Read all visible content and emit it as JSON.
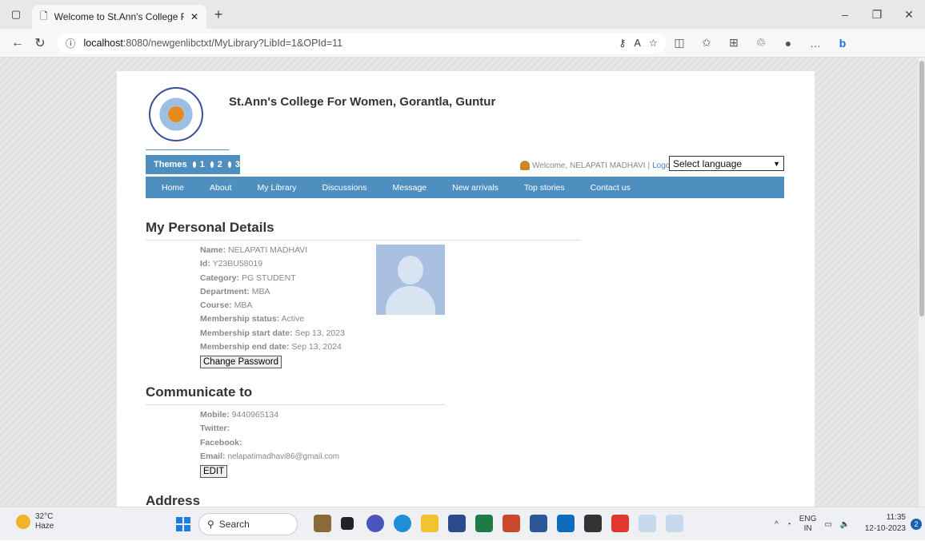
{
  "browser": {
    "tab_title": "Welcome to St.Ann's College For",
    "url_host": "localhost",
    "url_path": ":8080/newgenlibctxt/MyLibrary?LibId=1&OPId=11"
  },
  "site": {
    "college_name": "St.Ann's College For Women, Gorantla, Guntur",
    "themes_label": "Themes",
    "theme_options": [
      "1",
      "2",
      "3"
    ],
    "welcome_text": "Welcome, NELAPATI MADHAVI",
    "logout_label": "Logout",
    "language_select": "Select language",
    "menu": [
      "Home",
      "About",
      "My Library",
      "Discussions",
      "Message",
      "New arrivals",
      "Top stories",
      "Contact us"
    ]
  },
  "personal_details": {
    "title": "My Personal Details",
    "fields": [
      {
        "label": "Name:",
        "value": "NELAPATI MADHAVI"
      },
      {
        "label": "Id:",
        "value": "Y23BU58019"
      },
      {
        "label": "Category:",
        "value": "PG STUDENT"
      },
      {
        "label": "Department:",
        "value": "MBA"
      },
      {
        "label": "Course:",
        "value": "MBA"
      },
      {
        "label": "Membership status:",
        "value": "Active"
      },
      {
        "label": "Membership start date:",
        "value": "Sep 13, 2023"
      },
      {
        "label": "Membership end date:",
        "value": "Sep 13, 2024"
      }
    ],
    "change_password_label": "Change Password"
  },
  "communicate": {
    "title": "Communicate to",
    "fields": [
      {
        "label": "Mobile:",
        "value": "9440965134"
      },
      {
        "label": "Twitter:",
        "value": ""
      },
      {
        "label": "Facebook:",
        "value": ""
      },
      {
        "label": "Email:",
        "value": "nelapatimadhavi86@gmail.com"
      }
    ],
    "edit_label": "EDIT"
  },
  "address": {
    "title": "Address"
  },
  "taskbar": {
    "temperature": "32°C",
    "weather": "Haze",
    "search_label": "Search",
    "lang_line1": "ENG",
    "lang_line2": "IN",
    "time": "11:35",
    "date": "12-10-2023",
    "notification_count": "2"
  }
}
